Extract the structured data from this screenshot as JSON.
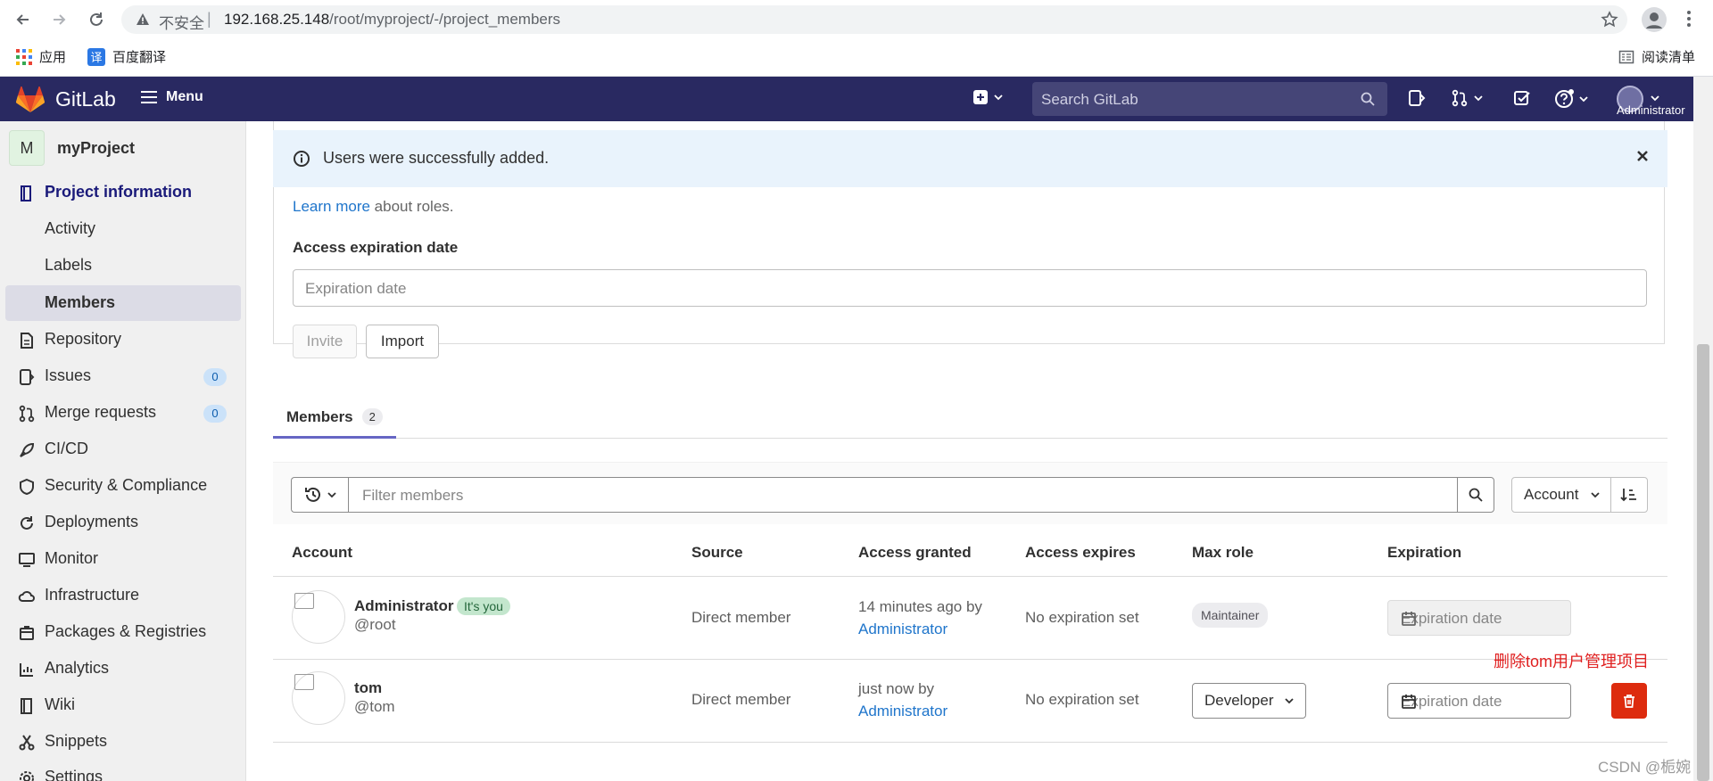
{
  "browser": {
    "insecure_label": "不安全",
    "url_host": "192.168.25.148",
    "url_path": "/root/myproject/-/project_members",
    "bookmarks": [
      {
        "label": "应用",
        "icon": "apps-grid-icon"
      },
      {
        "label": "百度翻译",
        "icon": "baidu-translate-icon"
      }
    ],
    "reading_list": "阅读清单"
  },
  "gitlab": {
    "brand": "GitLab",
    "menu_label": "Menu",
    "search_placeholder": "Search GitLab",
    "user_label": "Administrator"
  },
  "sidebar": {
    "project_initial": "M",
    "project_name": "myProject",
    "items": [
      {
        "label": "Project information",
        "icon": "book-icon"
      },
      {
        "label": "Activity"
      },
      {
        "label": "Labels"
      },
      {
        "label": "Members"
      },
      {
        "label": "Repository",
        "icon": "document-icon"
      },
      {
        "label": "Issues",
        "icon": "issues-icon",
        "count": "0"
      },
      {
        "label": "Merge requests",
        "icon": "merge-request-icon",
        "count": "0"
      },
      {
        "label": "CI/CD",
        "icon": "rocket-icon"
      },
      {
        "label": "Security & Compliance",
        "icon": "shield-icon"
      },
      {
        "label": "Deployments",
        "icon": "deployments-icon"
      },
      {
        "label": "Monitor",
        "icon": "monitor-icon"
      },
      {
        "label": "Infrastructure",
        "icon": "cloud-icon"
      },
      {
        "label": "Packages & Registries",
        "icon": "package-icon"
      },
      {
        "label": "Analytics",
        "icon": "chart-icon"
      },
      {
        "label": "Wiki",
        "icon": "book-icon"
      },
      {
        "label": "Snippets",
        "icon": "scissors-icon"
      },
      {
        "label": "Settings",
        "icon": "gear-icon"
      }
    ]
  },
  "invite": {
    "alert_text": "Users were successfully added.",
    "learn_more_link": "Learn more",
    "learn_more_rest": "about roles.",
    "expiration_label": "Access expiration date",
    "expiration_placeholder": "Expiration date",
    "invite_button": "Invite",
    "import_button": "Import"
  },
  "members": {
    "tab_label": "Members",
    "tab_count": "2",
    "filter_placeholder": "Filter members",
    "sort_label": "Account",
    "columns": [
      "Account",
      "Source",
      "Access granted",
      "Access expires",
      "Max role",
      "Expiration"
    ],
    "rows": [
      {
        "name": "Administrator",
        "badge": "It's you",
        "username": "@root",
        "source": "Direct member",
        "granted_time": "14 minutes ago by",
        "granted_by": "Administrator",
        "expires": "No expiration set",
        "role": "Maintainer",
        "expiration_placeholder": "Expiration date"
      },
      {
        "name": "tom",
        "username": "@tom",
        "source": "Direct member",
        "granted_time": "just now by",
        "granted_by": "Administrator",
        "expires": "No expiration set",
        "role": "Developer",
        "expiration_placeholder": "Expiration date"
      }
    ]
  },
  "annotation": "删除tom用户管理项目",
  "watermark": "CSDN @栀婉"
}
